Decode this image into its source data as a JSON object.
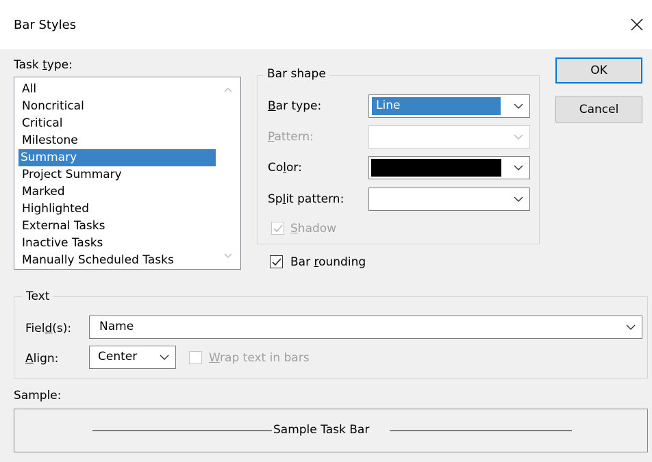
{
  "window": {
    "title": "Bar Styles",
    "close_icon": "close-icon"
  },
  "task_type": {
    "label_pre": "Task ",
    "label_key": "t",
    "label_post": "ype:",
    "items": [
      {
        "label": "All"
      },
      {
        "label": "Noncritical"
      },
      {
        "label": "Critical"
      },
      {
        "label": "Milestone"
      },
      {
        "label": "Summary",
        "selected": true
      },
      {
        "label": "Project Summary"
      },
      {
        "label": "Marked"
      },
      {
        "label": "Highlighted"
      },
      {
        "label": "External Tasks"
      },
      {
        "label": "Inactive Tasks"
      },
      {
        "label": "Manually Scheduled Tasks"
      }
    ]
  },
  "bar_shape": {
    "title": "Bar shape",
    "bar_type": {
      "label_key": "B",
      "label_rest": "ar type:",
      "value": "Line"
    },
    "pattern": {
      "label_key": "P",
      "label_rest": "attern:",
      "value": ""
    },
    "color": {
      "label_pre": "Co",
      "label_key": "l",
      "label_post": "or:",
      "value_color": "#000000"
    },
    "split_pattern": {
      "label_pre": "Sp",
      "label_key": "l",
      "label_post": "it pattern:",
      "value": ""
    },
    "shadow": {
      "label_key": "S",
      "label_rest": "hadow",
      "checked": true,
      "disabled": true
    }
  },
  "bar_rounding": {
    "label_pre": "Bar ",
    "label_key": "r",
    "label_post": "ounding",
    "checked": true
  },
  "buttons": {
    "ok": "OK",
    "cancel": "Cancel"
  },
  "text": {
    "title": "Text",
    "fields": {
      "label_pre": "Fiel",
      "label_key": "d",
      "label_post": "(s):",
      "value": "Name"
    },
    "align": {
      "label_key": "A",
      "label_rest": "lign:",
      "value": "Center"
    },
    "wrap": {
      "label_key": "W",
      "label_rest": "rap text in bars",
      "checked": false,
      "disabled": true
    }
  },
  "sample": {
    "label": "Sample:",
    "text": "Sample Task Bar"
  },
  "colors": {
    "accent": "#3a83c5",
    "focus": "#0078d7"
  }
}
